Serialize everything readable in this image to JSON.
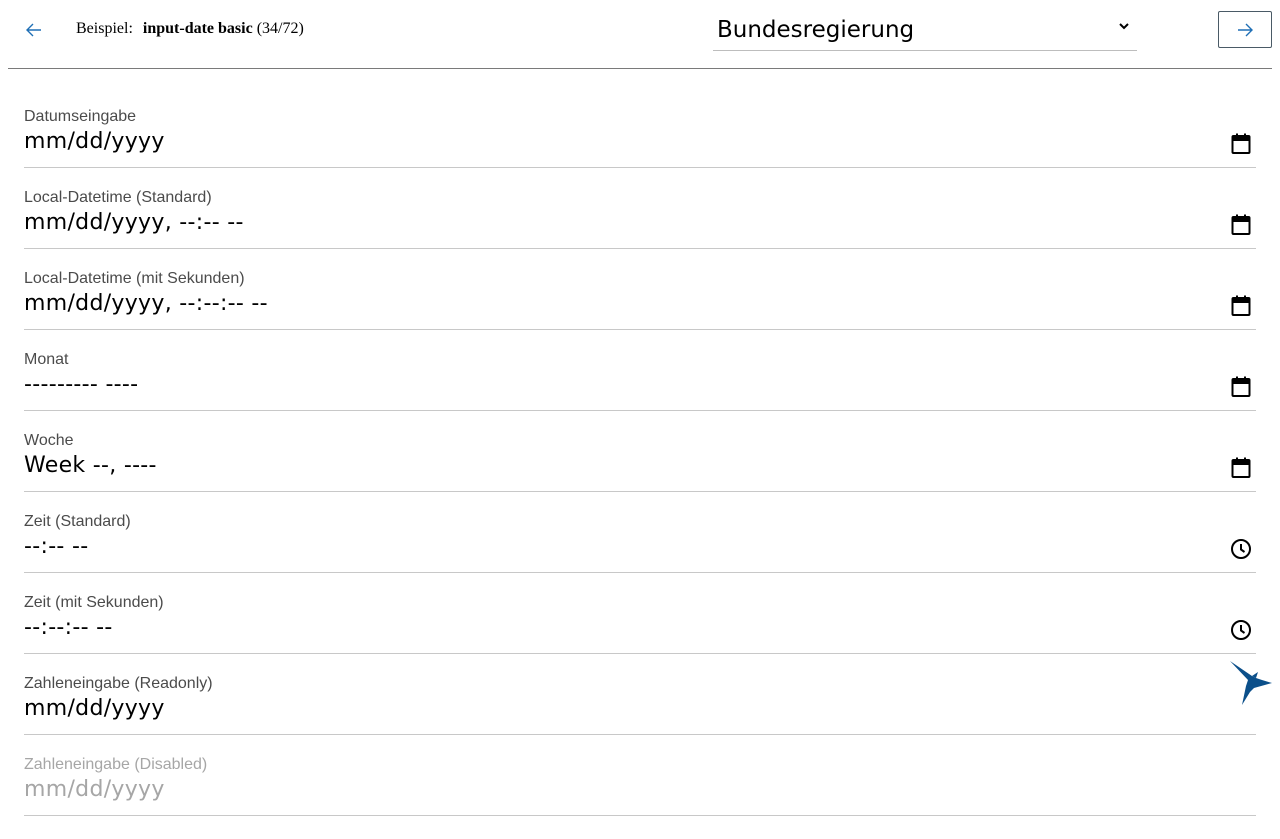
{
  "header": {
    "example_prefix": "Beispiel:",
    "example_name": "input-date basic",
    "example_count": "(34/72)",
    "theme_selected": "Bundesregierung",
    "back_icon": "arrow-left-icon",
    "next_icon": "arrow-right-icon",
    "accent": "#1f6fb5"
  },
  "fields": [
    {
      "label": "Datumseingabe",
      "placeholder": "mm/dd/yyyy",
      "icon": "calendar-icon"
    },
    {
      "label": "Local-Datetime (Standard)",
      "placeholder": "mm/dd/yyyy, --:-- --",
      "icon": "calendar-icon"
    },
    {
      "label": "Local-Datetime (mit Sekunden)",
      "placeholder": "mm/dd/yyyy, --:--:-- --",
      "icon": "calendar-icon"
    },
    {
      "label": "Monat",
      "placeholder": "--------- ----",
      "icon": "calendar-icon"
    },
    {
      "label": "Woche",
      "placeholder": "Week --, ----",
      "icon": "calendar-icon"
    },
    {
      "label": "Zeit (Standard)",
      "placeholder": "--:-- --",
      "icon": "clock-icon"
    },
    {
      "label": "Zeit (mit Sekunden)",
      "placeholder": "--:--:-- --",
      "icon": "clock-icon"
    },
    {
      "label": "Zahleneingabe (Readonly)",
      "placeholder": "mm/dd/yyyy",
      "icon": ""
    },
    {
      "label": "Zahleneingabe (Disabled)",
      "placeholder": "mm/dd/yyyy",
      "icon": ""
    }
  ],
  "logo_icon": "hummingbird-logo-icon",
  "logo_color": "#0b4f8a"
}
